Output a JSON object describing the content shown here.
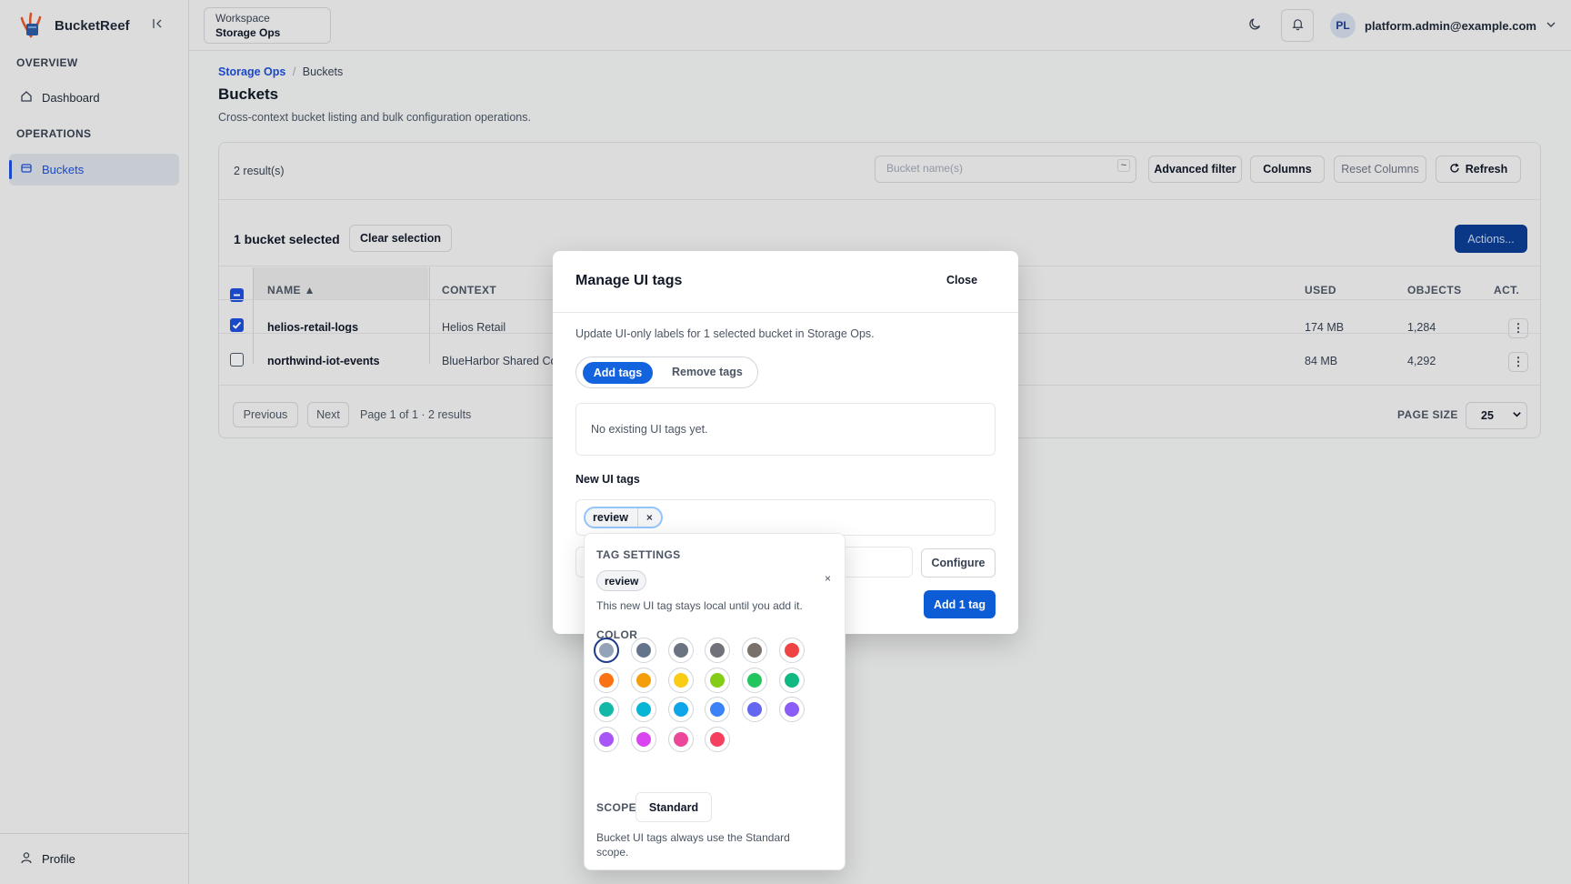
{
  "app": {
    "name": "BucketReef"
  },
  "sidebar": {
    "sections": [
      {
        "title": "OVERVIEW",
        "items": [
          {
            "label": "Dashboard"
          }
        ]
      },
      {
        "title": "OPERATIONS",
        "items": [
          {
            "label": "Buckets"
          }
        ]
      }
    ],
    "profile_label": "Profile"
  },
  "topbar": {
    "workspace_label": "Workspace",
    "workspace_value": "Storage Ops",
    "avatar_initials": "PL",
    "user_email": "platform.admin@example.com"
  },
  "page": {
    "breadcrumb_root": "Storage Ops",
    "breadcrumb_sep": "/",
    "breadcrumb_current": "Buckets",
    "title": "Buckets",
    "subtitle": "Cross-context bucket listing and bulk configuration operations."
  },
  "toolbar": {
    "result_count": "2 result(s)",
    "search_placeholder": "Bucket name(s)",
    "search_toggle": "~",
    "advanced_filter": "Advanced filter",
    "columns": "Columns",
    "reset_columns": "Reset Columns",
    "refresh": "Refresh"
  },
  "selection": {
    "label": "1 bucket selected",
    "clear": "Clear selection",
    "actions": "Actions..."
  },
  "table": {
    "columns": {
      "name": "NAME ▲",
      "context": "CONTEXT",
      "used": "USED",
      "objects": "OBJECTS",
      "actions": "ACT."
    },
    "rows": [
      {
        "name": "helios-retail-logs",
        "context": "Helios Retail",
        "used": "174 MB",
        "objects": "1,284",
        "selected": true
      },
      {
        "name": "northwind-iot-events",
        "context": "BlueHarbor Shared Co",
        "used": "84 MB",
        "objects": "4,292",
        "selected": false
      }
    ],
    "kebab": "⋮"
  },
  "pagination": {
    "previous": "Previous",
    "next": "Next",
    "info": "Page 1 of 1 · 2 results",
    "page_size_label": "PAGE SIZE",
    "page_size": "25"
  },
  "modal": {
    "title": "Manage UI tags",
    "close": "Close",
    "description": "Update UI-only labels for 1 selected bucket in Storage Ops.",
    "tab_add": "Add tags",
    "tab_remove": "Remove tags",
    "empty": "No existing UI tags yet.",
    "new_tags_label": "New UI tags",
    "chip": "review",
    "chip_remove": "×",
    "configure": "Configure",
    "submit": "Add 1 tag"
  },
  "tag_settings": {
    "heading": "TAG SETTINGS",
    "tag": "review",
    "close": "×",
    "note": "This new UI tag stays local until you add it.",
    "color_heading": "COLOR",
    "colors": [
      "#94a3b8",
      "#64748b",
      "#6b7280",
      "#71717a",
      "#78716c",
      "#ef4444",
      "#f97316",
      "#f59e0b",
      "#facc15",
      "#84cc16",
      "#22c55e",
      "#10b981",
      "#14b8a6",
      "#06b6d4",
      "#0ea5e9",
      "#3b82f6",
      "#6366f1",
      "#8b5cf6",
      "#a855f7",
      "#d946ef",
      "#ec4899",
      "#f43f5e"
    ],
    "selected_color": "#94a3b8",
    "scope_heading": "SCOPE",
    "scope_value": "Standard",
    "scope_help": "Bucket UI tags always use the Standard scope."
  }
}
